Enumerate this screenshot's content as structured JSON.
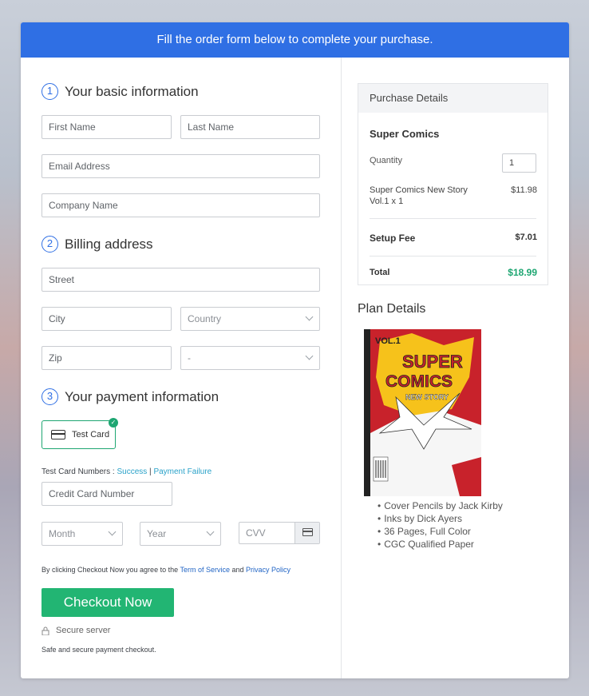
{
  "banner": "Fill the order form below to complete your purchase.",
  "sections": {
    "basic": {
      "num": "1",
      "title": "Your basic information"
    },
    "billing": {
      "num": "2",
      "title": "Billing address"
    },
    "payment": {
      "num": "3",
      "title": "Your payment information"
    }
  },
  "fields": {
    "first_name": "First Name",
    "last_name": "Last Name",
    "email": "Email Address",
    "company": "Company Name",
    "street": "Street",
    "city": "City",
    "country": "Country",
    "zip": "Zip",
    "state": "-",
    "card_number": "Credit Card Number",
    "month": "Month",
    "year": "Year",
    "cvv": "CVV"
  },
  "payment_method": "Test Card",
  "test_numbers": {
    "label": "Test Card Numbers : ",
    "success": "Success",
    "sep": " | ",
    "failure": "Payment Failure"
  },
  "terms": {
    "prefix": "By clicking Checkout Now you agree to the ",
    "tos": "Term of Service",
    "and": " and ",
    "privacy": "Privacy Policy"
  },
  "checkout_label": "Checkout Now",
  "secure_label": "Secure server",
  "safe_text": "Safe and secure payment checkout.",
  "purchase": {
    "header": "Purchase Details",
    "product": "Super Comics",
    "quantity_label": "Quantity",
    "quantity_value": "1",
    "item_line1": "Super Comics New Story",
    "item_line2": "Vol.1 x 1",
    "item_price": "$11.98",
    "setup_label": "Setup Fee",
    "setup_price": "$7.01",
    "total_label": "Total",
    "total_price": "$18.99"
  },
  "plan": {
    "title": "Plan Details",
    "cover_vol": "VOL.1",
    "cover_super": "SUPER",
    "cover_comics": "COMICS",
    "cover_story": "NEW STORY",
    "features": [
      "Cover Pencils by Jack Kirby",
      "Inks by Dick Ayers",
      "36 Pages, Full Color",
      "CGC Qualified Paper"
    ]
  },
  "colors": {
    "accent": "#2f6fe4",
    "success": "#22b573",
    "total": "#1ea672"
  }
}
